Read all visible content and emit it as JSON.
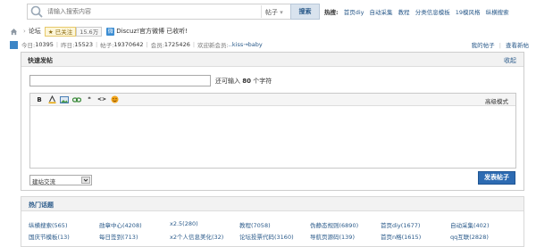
{
  "search": {
    "placeholder": "请输入搜索内容",
    "type_label": "帖子",
    "type_arrow": "▾",
    "button_label": "搜索",
    "hot_label": "热搜:",
    "hot_items": [
      "首页diy",
      "自动采集",
      "教程",
      "分类信息模板",
      "19模风格",
      "纵横搜索"
    ]
  },
  "breadcrumb": {
    "separator": "›",
    "forum": "论坛",
    "follow_label": "已关注",
    "follow_count": "15.6万",
    "weibo_text": "Discuz!官方微博 已收听!"
  },
  "stats": {
    "today_label": "今日: ",
    "today": "10395",
    "yesterday_label": "昨日: ",
    "yesterday": "15523",
    "posts_label": "帖子: ",
    "posts": "19370642",
    "members_label": "会员: ",
    "members": "1725426",
    "welcome_label": "欢迎新会员: ",
    "new_member": "..kiss→baby",
    "separator": "|"
  },
  "top_links": {
    "my_posts": "我的帖子",
    "new_posts": "查看新帖",
    "separator": "|"
  },
  "quick_post": {
    "title": "快速发帖",
    "collapse": "收起",
    "hint_prefix": "还可输入 ",
    "hint_count": "80",
    "hint_suffix": " 个字符",
    "advanced_mode": "高级模式",
    "forum_select_value": "建站交流",
    "submit_label": "发表帖子",
    "toolbar": {
      "bold": "B",
      "quote": "❝",
      "code": "<>"
    }
  },
  "hot_topics": {
    "title": "热门话题",
    "rows": [
      [
        "纵横搜索(565)",
        "勋章中心(4208)",
        "x2.5(280)",
        "教程(7058)",
        "伪静态规则(6890)",
        "首页diy(1677)",
        "自动采集(402)"
      ],
      [
        "国庆节模板(13)",
        "每日签到(713)",
        "x2个人信息美化(32)",
        "论坛投票代码(3160)",
        "导航页源码(139)",
        "首页n格(1615)",
        "qq互联(2828)"
      ]
    ]
  }
}
